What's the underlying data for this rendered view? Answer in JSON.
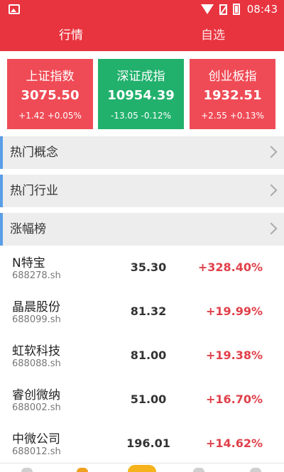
{
  "status_bar": {
    "time": "08:43"
  },
  "tabs": [
    {
      "label": "行情"
    },
    {
      "label": "自选"
    }
  ],
  "colors": {
    "header": "#e8343f",
    "up": "#ef4b56",
    "down": "#22b16d",
    "up_text": "#e0404a"
  },
  "indices": [
    {
      "name": "上证指数",
      "value": "3075.50",
      "change": "+1.42 +0.05%",
      "trend": "up"
    },
    {
      "name": "深证成指",
      "value": "10954.39",
      "change": "-13.05 -0.12%",
      "trend": "down"
    },
    {
      "name": "创业板指",
      "value": "1932.51",
      "change": "+2.55 +0.13%",
      "trend": "up"
    }
  ],
  "sections": [
    {
      "label": "热门概念"
    },
    {
      "label": "热门行业"
    },
    {
      "label": "涨幅榜"
    }
  ],
  "stocks": [
    {
      "name": "N特宝",
      "code": "688278.sh",
      "price": "35.30",
      "pct": "+328.40%"
    },
    {
      "name": "晶晨股份",
      "code": "688099.sh",
      "price": "81.32",
      "pct": "+19.99%"
    },
    {
      "name": "虹软科技",
      "code": "688088.sh",
      "price": "81.00",
      "pct": "+19.38%"
    },
    {
      "name": "睿创微纳",
      "code": "688002.sh",
      "price": "51.00",
      "pct": "+16.70%"
    },
    {
      "name": "中微公司",
      "code": "688012.sh",
      "price": "196.01",
      "pct": "+14.62%"
    }
  ]
}
